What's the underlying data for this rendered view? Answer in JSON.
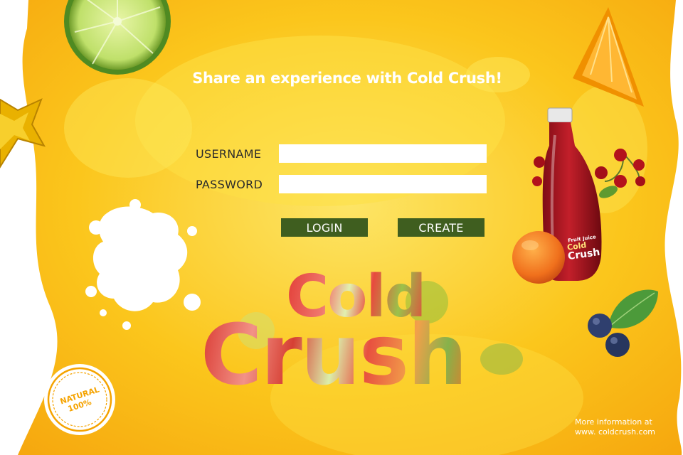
{
  "tagline": "Share an experience with Cold Crush!",
  "form": {
    "username_label": "USERNAME",
    "username_value": "",
    "password_label": "PASSWORD",
    "password_value": ""
  },
  "buttons": {
    "login_label": "LOGIN",
    "create_label": "CREATE"
  },
  "brand": {
    "line1": "Cold",
    "line2": "Crush"
  },
  "bottle_label": {
    "line1": "Fruit Juice",
    "line2": "Cold",
    "line3": "Crush"
  },
  "badge": {
    "line1": "NATURAL",
    "line2": "100%"
  },
  "info": {
    "line1": "More information at",
    "line2": "www. coldcrush.com"
  },
  "colors": {
    "background_yellow": "#fbc417",
    "button_green": "#3f5e1f",
    "text_white": "#ffffff"
  },
  "icons": [
    "lime-slice",
    "starfruit",
    "orange-slice",
    "juice-bottle",
    "cherries",
    "apricot",
    "blueberries",
    "mint-leaf",
    "milk-splash",
    "natural-badge"
  ]
}
